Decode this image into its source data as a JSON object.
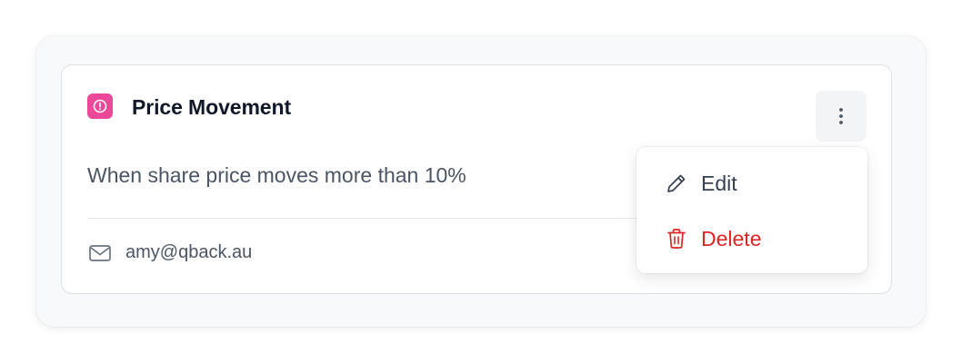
{
  "alert": {
    "title": "Price Movement",
    "description": "When share price moves more than 10%",
    "recipient_email": "amy@qback.au",
    "badge_icon": "alert-circle-icon",
    "badge_color": "#ec4899"
  },
  "menu": {
    "trigger_icon": "more-vertical-icon",
    "items": [
      {
        "label": "Edit",
        "icon": "pencil-icon",
        "color": "#374151"
      },
      {
        "label": "Delete",
        "icon": "trash-icon",
        "color": "#dc2626"
      }
    ]
  }
}
